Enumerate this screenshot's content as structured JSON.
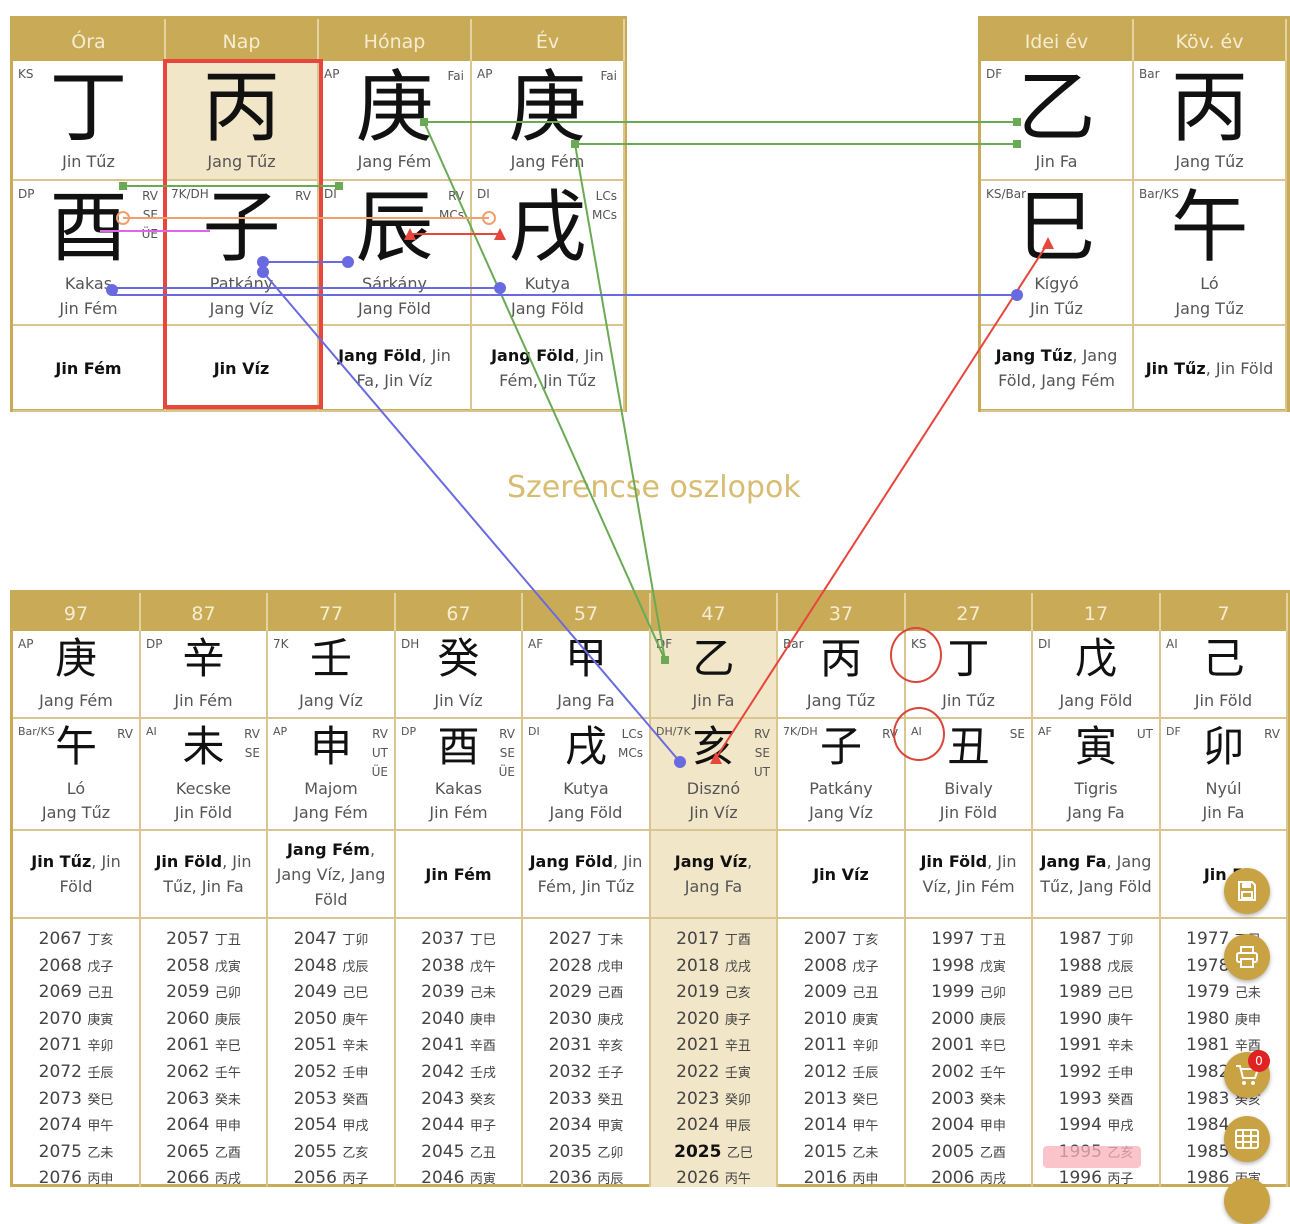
{
  "natal": {
    "headers": [
      "Óra",
      "Nap",
      "Hónap",
      "Év"
    ],
    "stems": [
      {
        "tag": "KS",
        "tag2": "",
        "char": "丁",
        "name": "Jin Tűz"
      },
      {
        "tag": "",
        "tag2": "",
        "char": "丙",
        "name": "Jang Tűz"
      },
      {
        "tag": "AP",
        "tag2": "Fai",
        "char": "庚",
        "name": "Jang Fém"
      },
      {
        "tag": "AP",
        "tag2": "Fai",
        "char": "庚",
        "name": "Jang Fém"
      }
    ],
    "branches": [
      {
        "tag": "DP",
        "tag2": "RV\nSE\nÜE",
        "char": "酉",
        "animal": "Kakas",
        "element": "Jin Fém"
      },
      {
        "tag": "7K/DH",
        "tag2": "RV",
        "char": "子",
        "animal": "Patkány",
        "element": "Jang Víz"
      },
      {
        "tag": "DI",
        "tag2": "RV\nMCs",
        "char": "辰",
        "animal": "Sárkány",
        "element": "Jang Föld"
      },
      {
        "tag": "DI",
        "tag2": "LCs\nMCs",
        "char": "戌",
        "animal": "Kutya",
        "element": "Jang Föld"
      }
    ],
    "hidden": [
      {
        "main": "Jin Fém",
        "rest": ""
      },
      {
        "main": "Jin Víz",
        "rest": ""
      },
      {
        "main": "Jang Föld",
        "rest": ", Jin Fa, Jin Víz"
      },
      {
        "main": "Jang Föld",
        "rest": ", Jin Fém, Jin Tűz"
      }
    ]
  },
  "annual": {
    "headers": [
      "Idei év",
      "Köv. év"
    ],
    "stems": [
      {
        "tag": "DF",
        "tag2": "",
        "char": "乙",
        "name": "Jin Fa"
      },
      {
        "tag": "Bar",
        "tag2": "",
        "char": "丙",
        "name": "Jang Tűz"
      }
    ],
    "branches": [
      {
        "tag": "KS/Bar",
        "tag2": "",
        "char": "巳",
        "animal": "Kígyó",
        "element": "Jin Tűz"
      },
      {
        "tag": "Bar/KS",
        "tag2": "",
        "char": "午",
        "animal": "Ló",
        "element": "Jang Tűz"
      }
    ],
    "hidden": [
      {
        "main": "Jang Tűz",
        "rest": ", Jang Föld, Jang Fém"
      },
      {
        "main": "Jin Tűz",
        "rest": ", Jin Föld"
      }
    ]
  },
  "luck_title": "Szerencse oszlopok",
  "luck": [
    {
      "age": "97",
      "stemTag": "AP",
      "stem": "庚",
      "stemName": "Jang Fém",
      "brTag": "Bar/KS",
      "brTag2": "RV",
      "branch": "午",
      "animal": "Ló",
      "brElem": "Jang Tűz",
      "hidMain": "Jin Tűz",
      "hidRest": ", Jin Föld",
      "years": [
        [
          "2067",
          "丁亥"
        ],
        [
          "2068",
          "戊子"
        ],
        [
          "2069",
          "己丑"
        ],
        [
          "2070",
          "庚寅"
        ],
        [
          "2071",
          "辛卯"
        ],
        [
          "2072",
          "壬辰"
        ],
        [
          "2073",
          "癸巳"
        ],
        [
          "2074",
          "甲午"
        ],
        [
          "2075",
          "乙未"
        ],
        [
          "2076",
          "丙申"
        ]
      ]
    },
    {
      "age": "87",
      "stemTag": "DP",
      "stem": "辛",
      "stemName": "Jin Fém",
      "brTag": "AI",
      "brTag2": "RV\nSE",
      "branch": "未",
      "animal": "Kecske",
      "brElem": "Jin Föld",
      "hidMain": "Jin Föld",
      "hidRest": ", Jin Tűz, Jin Fa",
      "years": [
        [
          "2057",
          "丁丑"
        ],
        [
          "2058",
          "戊寅"
        ],
        [
          "2059",
          "己卯"
        ],
        [
          "2060",
          "庚辰"
        ],
        [
          "2061",
          "辛巳"
        ],
        [
          "2062",
          "壬午"
        ],
        [
          "2063",
          "癸未"
        ],
        [
          "2064",
          "甲申"
        ],
        [
          "2065",
          "乙酉"
        ],
        [
          "2066",
          "丙戌"
        ]
      ]
    },
    {
      "age": "77",
      "stemTag": "7K",
      "stem": "壬",
      "stemName": "Jang Víz",
      "brTag": "AP",
      "brTag2": "RV\nUT\nÜE",
      "branch": "申",
      "animal": "Majom",
      "brElem": "Jang Fém",
      "hidMain": "Jang Fém",
      "hidRest": ", Jang Víz, Jang Föld",
      "years": [
        [
          "2047",
          "丁卯"
        ],
        [
          "2048",
          "戊辰"
        ],
        [
          "2049",
          "己巳"
        ],
        [
          "2050",
          "庚午"
        ],
        [
          "2051",
          "辛未"
        ],
        [
          "2052",
          "壬申"
        ],
        [
          "2053",
          "癸酉"
        ],
        [
          "2054",
          "甲戌"
        ],
        [
          "2055",
          "乙亥"
        ],
        [
          "2056",
          "丙子"
        ]
      ]
    },
    {
      "age": "67",
      "stemTag": "DH",
      "stem": "癸",
      "stemName": "Jin Víz",
      "brTag": "DP",
      "brTag2": "RV\nSE\nÜE",
      "branch": "酉",
      "animal": "Kakas",
      "brElem": "Jin Fém",
      "hidMain": "Jin Fém",
      "hidRest": "",
      "years": [
        [
          "2037",
          "丁巳"
        ],
        [
          "2038",
          "戊午"
        ],
        [
          "2039",
          "己未"
        ],
        [
          "2040",
          "庚申"
        ],
        [
          "2041",
          "辛酉"
        ],
        [
          "2042",
          "壬戌"
        ],
        [
          "2043",
          "癸亥"
        ],
        [
          "2044",
          "甲子"
        ],
        [
          "2045",
          "乙丑"
        ],
        [
          "2046",
          "丙寅"
        ]
      ]
    },
    {
      "age": "57",
      "stemTag": "AF",
      "stem": "甲",
      "stemName": "Jang Fa",
      "brTag": "DI",
      "brTag2": "LCs\nMCs",
      "branch": "戌",
      "animal": "Kutya",
      "brElem": "Jang Föld",
      "hidMain": "Jang Föld",
      "hidRest": ", Jin Fém, Jin Tűz",
      "years": [
        [
          "2027",
          "丁未"
        ],
        [
          "2028",
          "戊申"
        ],
        [
          "2029",
          "己酉"
        ],
        [
          "2030",
          "庚戌"
        ],
        [
          "2031",
          "辛亥"
        ],
        [
          "2032",
          "壬子"
        ],
        [
          "2033",
          "癸丑"
        ],
        [
          "2034",
          "甲寅"
        ],
        [
          "2035",
          "乙卯"
        ],
        [
          "2036",
          "丙辰"
        ]
      ]
    },
    {
      "age": "47",
      "stemTag": "DF",
      "stem": "乙",
      "stemName": "Jin Fa",
      "brTag": "DH/7K",
      "brTag2": "RV\nSE\nUT",
      "branch": "亥",
      "animal": "Disznó",
      "brElem": "Jin Víz",
      "hidMain": "Jang Víz",
      "hidRest": ", Jang Fa",
      "years": [
        [
          "2017",
          "丁酉"
        ],
        [
          "2018",
          "戊戌"
        ],
        [
          "2019",
          "己亥"
        ],
        [
          "2020",
          "庚子"
        ],
        [
          "2021",
          "辛丑"
        ],
        [
          "2022",
          "壬寅"
        ],
        [
          "2023",
          "癸卯"
        ],
        [
          "2024",
          "甲辰"
        ],
        [
          "2025",
          "乙巳"
        ],
        [
          "2026",
          "丙午"
        ]
      ]
    },
    {
      "age": "37",
      "stemTag": "Bar",
      "stem": "丙",
      "stemName": "Jang Tűz",
      "brTag": "7K/DH",
      "brTag2": "RV",
      "branch": "子",
      "animal": "Patkány",
      "brElem": "Jang Víz",
      "hidMain": "Jin Víz",
      "hidRest": "",
      "years": [
        [
          "2007",
          "丁亥"
        ],
        [
          "2008",
          "戊子"
        ],
        [
          "2009",
          "己丑"
        ],
        [
          "2010",
          "庚寅"
        ],
        [
          "2011",
          "辛卯"
        ],
        [
          "2012",
          "壬辰"
        ],
        [
          "2013",
          "癸巳"
        ],
        [
          "2014",
          "甲午"
        ],
        [
          "2015",
          "乙未"
        ],
        [
          "2016",
          "丙申"
        ]
      ]
    },
    {
      "age": "27",
      "stemTag": "KS",
      "stem": "丁",
      "stemName": "Jin Tűz",
      "brTag": "AI",
      "brTag2": "SE",
      "branch": "丑",
      "animal": "Bivaly",
      "brElem": "Jin Föld",
      "hidMain": "Jin Föld",
      "hidRest": ", Jin Víz, Jin Fém",
      "years": [
        [
          "1997",
          "丁丑"
        ],
        [
          "1998",
          "戊寅"
        ],
        [
          "1999",
          "己卯"
        ],
        [
          "2000",
          "庚辰"
        ],
        [
          "2001",
          "辛巳"
        ],
        [
          "2002",
          "壬午"
        ],
        [
          "2003",
          "癸未"
        ],
        [
          "2004",
          "甲申"
        ],
        [
          "2005",
          "乙酉"
        ],
        [
          "2006",
          "丙戌"
        ]
      ]
    },
    {
      "age": "17",
      "stemTag": "DI",
      "stem": "戊",
      "stemName": "Jang Föld",
      "brTag": "AF",
      "brTag2": "UT",
      "branch": "寅",
      "animal": "Tigris",
      "brElem": "Jang Fa",
      "hidMain": "Jang Fa",
      "hidRest": ", Jang Tűz, Jang Föld",
      "years": [
        [
          "1987",
          "丁卯"
        ],
        [
          "1988",
          "戊辰"
        ],
        [
          "1989",
          "己巳"
        ],
        [
          "1990",
          "庚午"
        ],
        [
          "1991",
          "辛未"
        ],
        [
          "1992",
          "壬申"
        ],
        [
          "1993",
          "癸酉"
        ],
        [
          "1994",
          "甲戌"
        ],
        [
          "1995",
          "乙亥"
        ],
        [
          "1996",
          "丙子"
        ]
      ]
    },
    {
      "age": "7",
      "stemTag": "AI",
      "stem": "己",
      "stemName": "Jin Föld",
      "brTag": "DF",
      "brTag2": "RV",
      "branch": "卯",
      "animal": "Nyúl",
      "brElem": "Jin Fa",
      "hidMain": "Jin F",
      "hidRest": "",
      "years": [
        [
          "1977",
          "丁巳"
        ],
        [
          "1978",
          "戊午"
        ],
        [
          "1979",
          "己未"
        ],
        [
          "1980",
          "庚申"
        ],
        [
          "1981",
          "辛酉"
        ],
        [
          "1982",
          "壬戌"
        ],
        [
          "1983",
          "癸亥"
        ],
        [
          "1984",
          "甲子"
        ],
        [
          "1985",
          "乙丑"
        ],
        [
          "1986",
          "丙寅"
        ]
      ]
    }
  ],
  "current_year": "2025",
  "birth_year": "1996",
  "cart_count": "0",
  "icons": {
    "save": "save-icon",
    "print": "print-icon",
    "cart": "cart-icon",
    "grid": "grid-icon"
  },
  "colors": {
    "gold": "#c9ab57",
    "highlight": "#f1e6c8",
    "red": "#e8453c",
    "green": "#6aaa55",
    "blue": "#6a6ae0",
    "orange": "#f0a070",
    "magenta": "#e066e8"
  }
}
